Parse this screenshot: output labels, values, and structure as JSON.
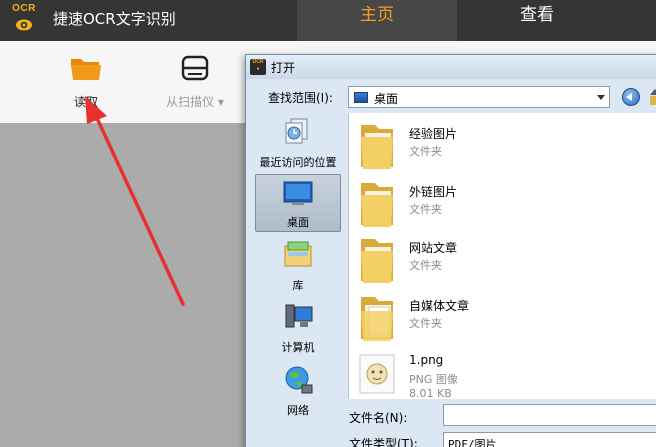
{
  "app": {
    "logo_text": "OCR",
    "title": "捷速OCR文字识别",
    "tabs": [
      {
        "label": "主页",
        "active": true
      },
      {
        "label": "查看",
        "active": false
      }
    ],
    "accent_color": "#f2a01c"
  },
  "toolbar": {
    "read_label": "读取",
    "scan_label": "从扫描仪",
    "scan_dropdown_glyph": "▾"
  },
  "dialog": {
    "title": "打开",
    "look_in_label": "查找范围(I):",
    "look_in_value": "桌面",
    "places": [
      {
        "label": "最近访问的位置",
        "icon": "recent-places-icon"
      },
      {
        "label": "桌面",
        "icon": "desktop-icon",
        "selected": true
      },
      {
        "label": "库",
        "icon": "libraries-icon"
      },
      {
        "label": "计算机",
        "icon": "computer-icon"
      },
      {
        "label": "网络",
        "icon": "network-icon"
      }
    ],
    "files": [
      {
        "name": "经验图片",
        "type": "文件夹"
      },
      {
        "name": "外链图片",
        "type": "文件夹"
      },
      {
        "name": "网站文章",
        "type": "文件夹"
      },
      {
        "name": "自媒体文章",
        "type": "文件夹"
      },
      {
        "name": "1.png",
        "type": "PNG 图像",
        "size": "8.01 KB"
      }
    ],
    "filename_label": "文件名(N):",
    "filename_value": "",
    "filetype_label": "文件类型(T):",
    "filetype_value": "PDF/图片"
  }
}
